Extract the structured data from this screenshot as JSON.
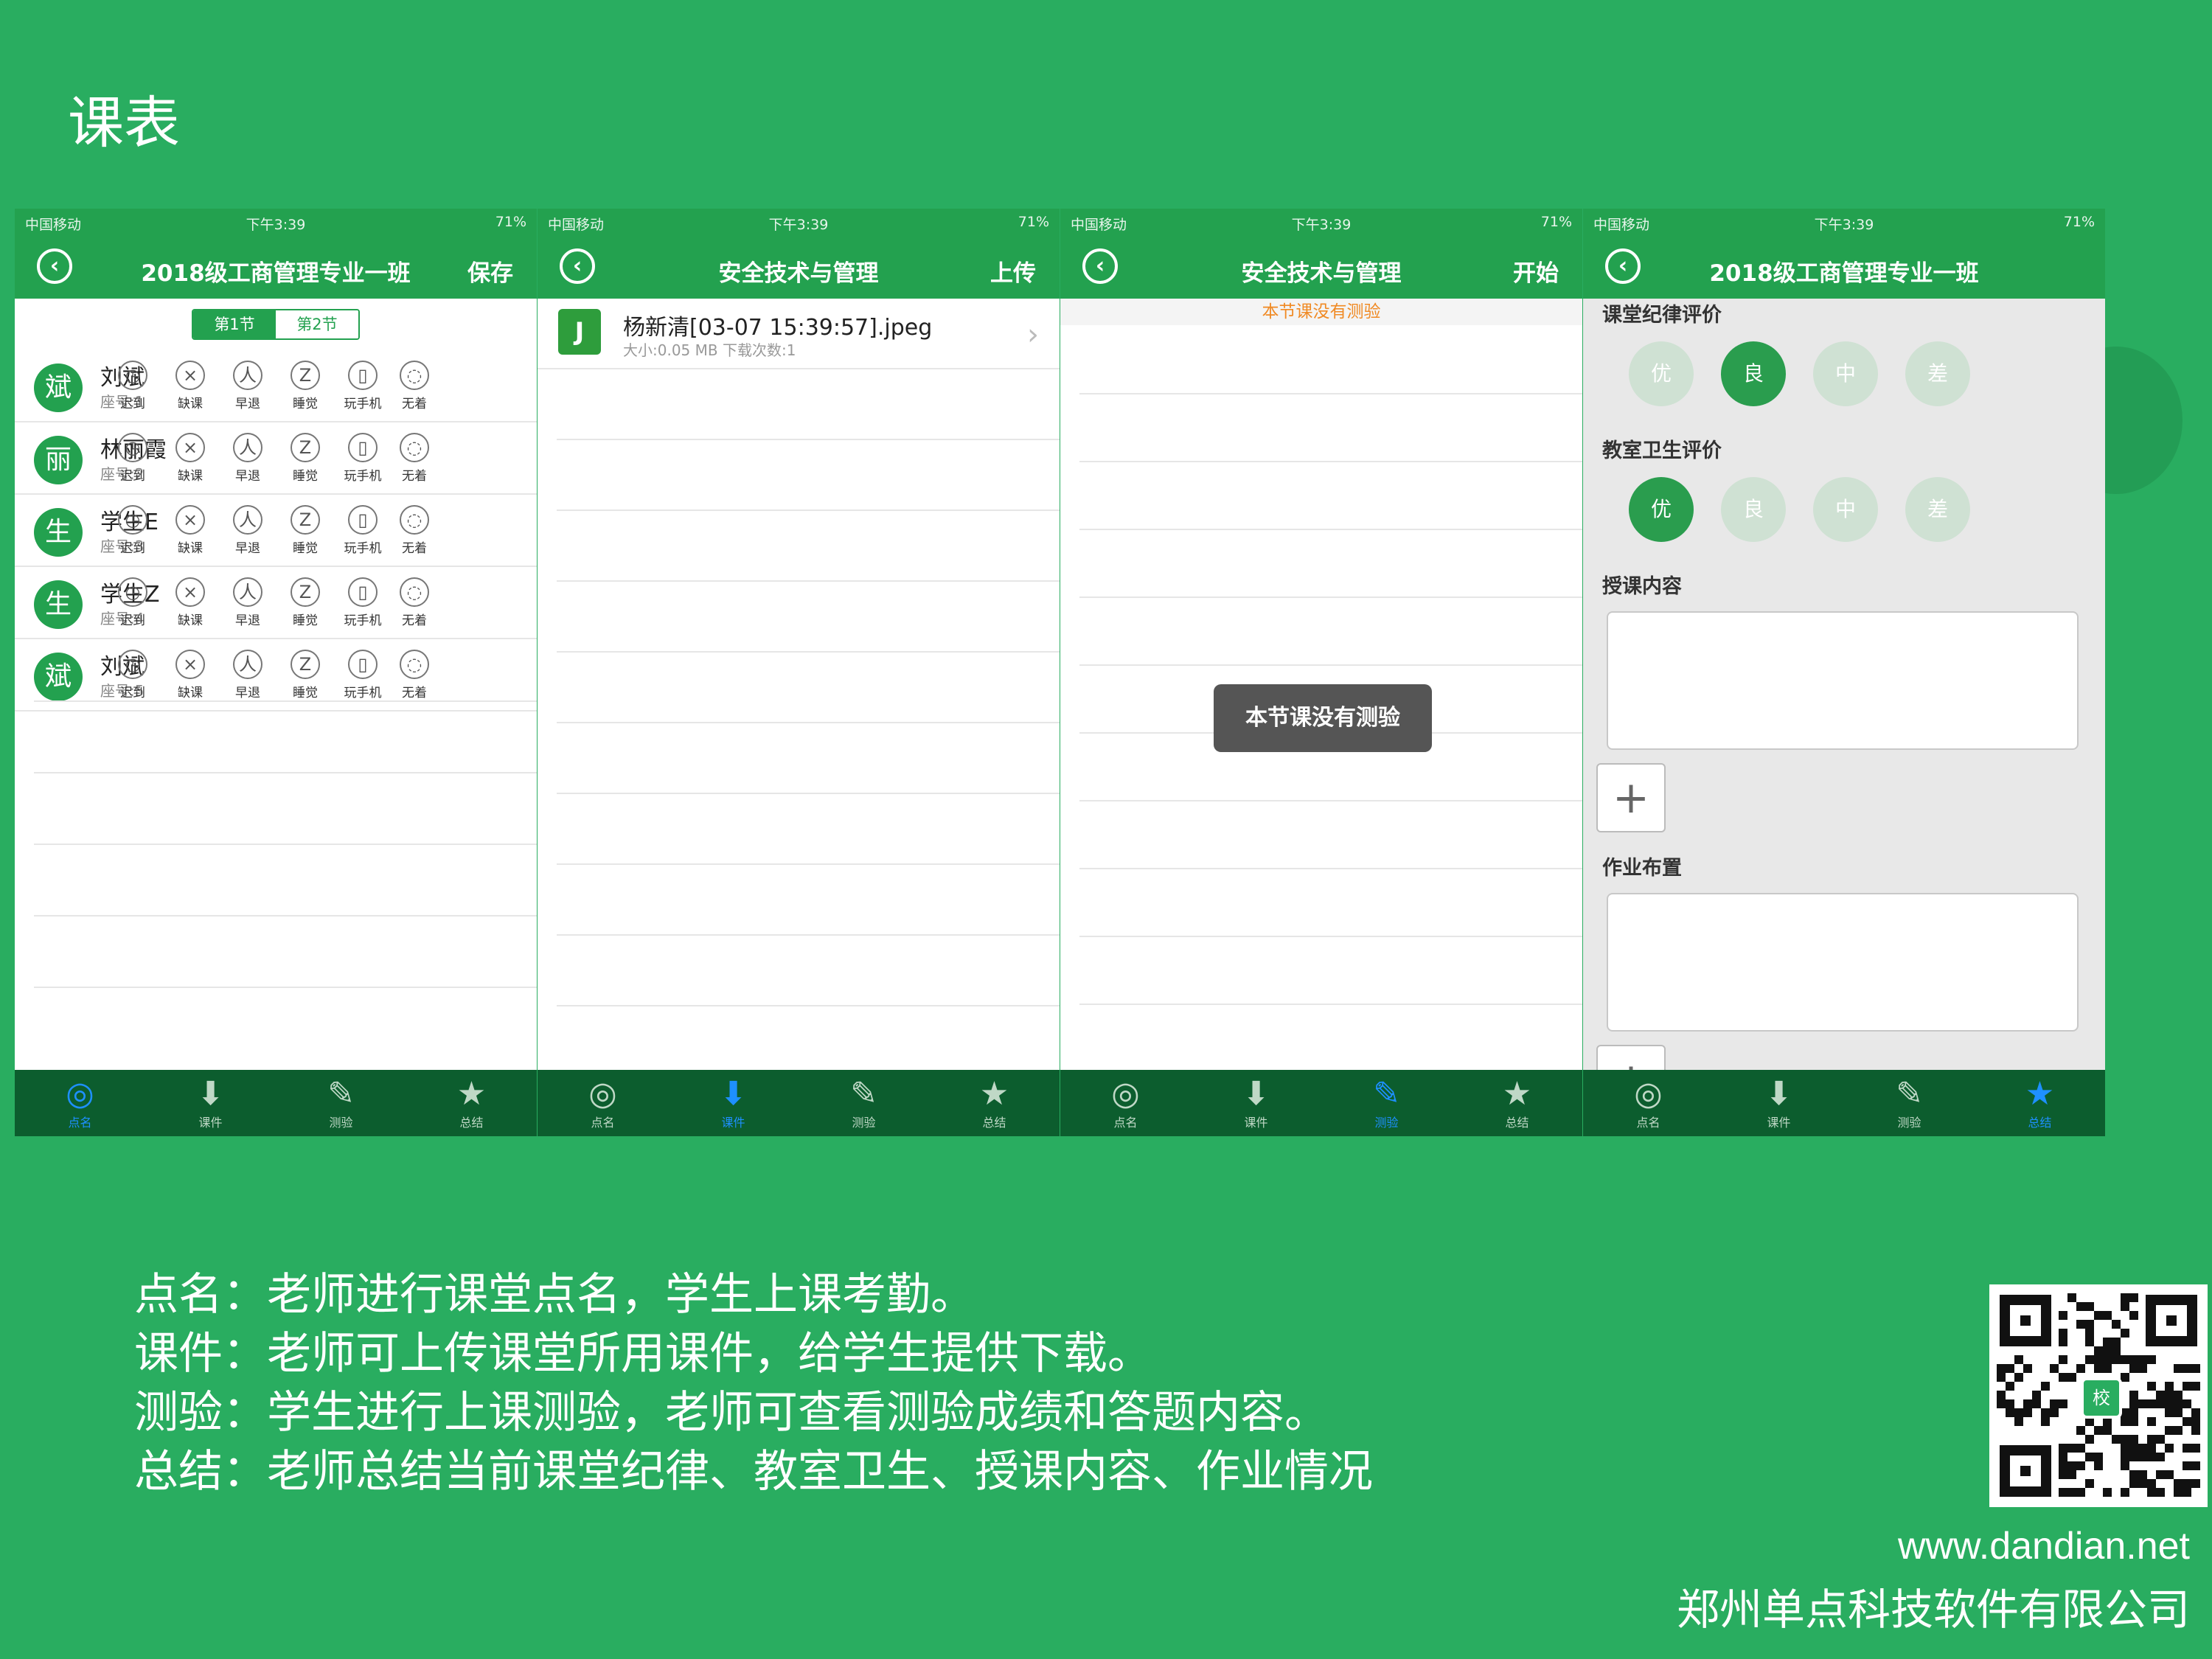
{
  "slide": {
    "title": "课表"
  },
  "status": {
    "carrier": "中国移动",
    "time": "下午3:39",
    "battery": "71%"
  },
  "tabs": [
    {
      "label": "点名",
      "icon": "check-circle-icon"
    },
    {
      "label": "课件",
      "icon": "download-arrow-icon"
    },
    {
      "label": "测验",
      "icon": "pencil-icon"
    },
    {
      "label": "总结",
      "icon": "star-icon"
    }
  ],
  "screen1": {
    "nav_title": "2018级工商管理专业一班",
    "nav_action": "保存",
    "segments": [
      "第1节",
      "第2节"
    ],
    "attendance_labels": [
      "迟到",
      "缺课",
      "早退",
      "睡觉",
      "玩手机",
      "无着"
    ],
    "students": [
      {
        "avatar": "斌",
        "name": "刘斌",
        "seat": "座号:1"
      },
      {
        "avatar": "丽",
        "name": "林丽霞",
        "seat": "座号:2"
      },
      {
        "avatar": "生",
        "name": "学生E",
        "seat": "座号:3"
      },
      {
        "avatar": "生",
        "name": "学生Z",
        "seat": "座号:4"
      },
      {
        "avatar": "斌",
        "name": "刘斌",
        "seat": "座号:5"
      }
    ]
  },
  "screen2": {
    "nav_title": "安全技术与管理",
    "nav_action": "上传",
    "file": {
      "icon_letter": "J",
      "name": "杨新清[03-07 15:39:57].jpeg",
      "meta": "大小:0.05 MB  下载次数:1"
    }
  },
  "screen3": {
    "nav_title": "安全技术与管理",
    "nav_action": "开始",
    "banner": "本节课没有测验",
    "toast": "本节课没有测验"
  },
  "screen4": {
    "nav_title": "2018级工商管理专业一班",
    "discipline_title": "课堂纪律评价",
    "hygiene_title": "教室卫生评价",
    "ratings": [
      "优",
      "良",
      "中",
      "差"
    ],
    "discipline_selected": "良",
    "hygiene_selected": "优",
    "content_title": "授课内容",
    "homework_title": "作业布置",
    "add_symbol": "+"
  },
  "caption": [
    "点名：老师进行课堂点名，学生上课考勤。",
    "课件：老师可上传课堂所用课件，给学生提供下载。",
    "测验：学生进行上课测验，老师可查看测验成绩和答题内容。",
    "总结：老师总结当前课堂纪律、教室卫生、授课内容、作业情况"
  ],
  "qr": {
    "logo_text": "校"
  },
  "footer": {
    "url": "www.dandian.net",
    "company": "郑州单点科技软件有限公司"
  },
  "colors": {
    "background": "#29ad60",
    "nav": "#23a14f",
    "tabbar": "#0c5d2e",
    "active_tab": "#1e90ff",
    "warning": "#f08a24"
  }
}
